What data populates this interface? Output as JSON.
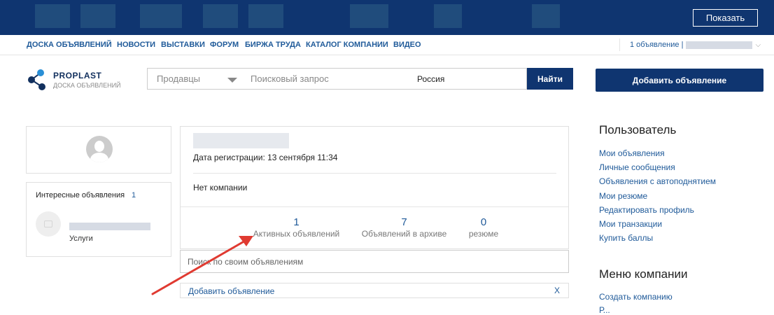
{
  "topbar": {
    "show_button": "Показать"
  },
  "nav": {
    "items": [
      "ДОСКА ОБЪЯВЛЕНИЙ",
      "НОВОСТИ",
      "ВЫСТАВКИ",
      "ФОРУМ",
      "БИРЖА ТРУДА",
      "КАТАЛОГ КОМПАНИИ",
      "ВИДЕО"
    ],
    "user_ads": "1 объявление |"
  },
  "logo": {
    "title": "PROPLAST",
    "subtitle": "ДОСКА ОБЪЯВЛЕНИЙ"
  },
  "search": {
    "seller_select": "Продавцы",
    "query_placeholder": "Поисковый запрос",
    "region": "Россия",
    "find_button": "Найти"
  },
  "add_ad_button": "Добавить объявление",
  "favorites": {
    "title": "Интересные объявления",
    "count": "1",
    "item_category": "Услуги"
  },
  "profile": {
    "reg_date": "Дата регистрации: 13 сентября 11:34",
    "company": "Нет компании",
    "stats": [
      {
        "value": "1",
        "label": "Активных объявлений"
      },
      {
        "value": "7",
        "label": "Объявлений в архиве"
      },
      {
        "value": "0",
        "label": "резюме"
      }
    ]
  },
  "own_search_placeholder": "Поиск по своим объявлениям",
  "add_ad_bar": {
    "label": "Добавить объявление",
    "close": "X"
  },
  "sidebar": {
    "user_heading": "Пользователь",
    "user_links": [
      "Мои объявления",
      "Личные сообщения",
      "Объявления с автоподнятием",
      "Мои резюме",
      "Редактировать профиль",
      "Мои транзакции",
      "Купить баллы"
    ],
    "company_heading": "Меню компании",
    "company_links": [
      "Создать компанию",
      "Р..."
    ]
  },
  "colors": {
    "navy": "#0f3570",
    "link": "#1f5a99",
    "annotation_arrow": "#e03a31"
  }
}
